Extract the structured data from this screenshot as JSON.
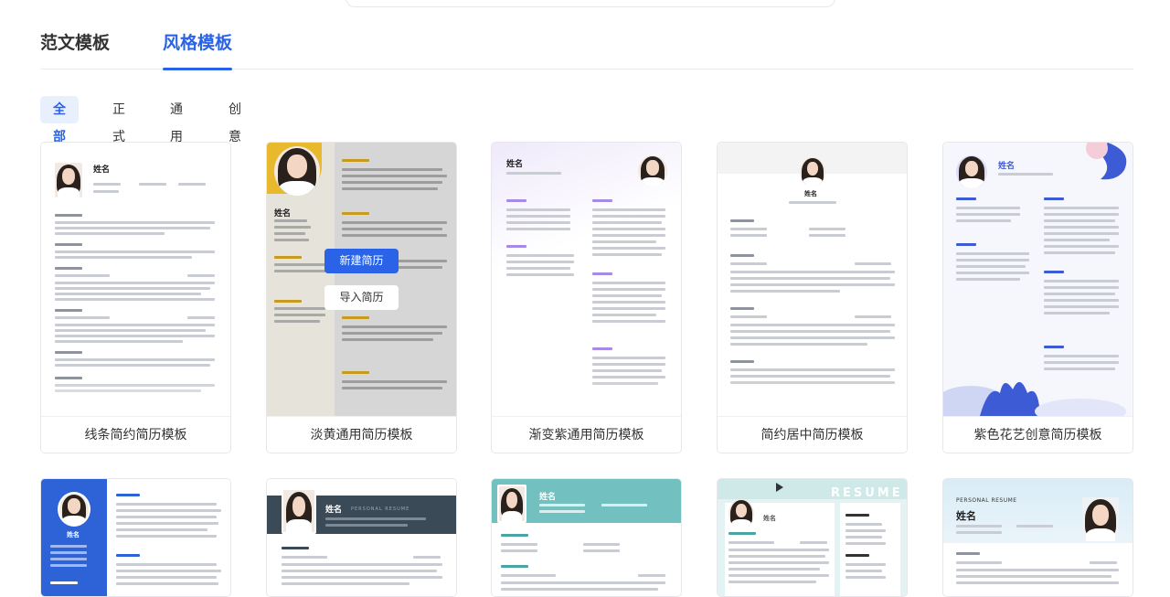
{
  "tabs": [
    {
      "label": "范文模板",
      "active": false
    },
    {
      "label": "风格模板",
      "active": true
    }
  ],
  "filters": [
    {
      "label": "全部",
      "active": true
    },
    {
      "label": "正式",
      "active": false
    },
    {
      "label": "通用",
      "active": false
    },
    {
      "label": "创意",
      "active": false
    }
  ],
  "hover_actions": {
    "new_label": "新建简历",
    "import_label": "导入简历"
  },
  "templates": [
    {
      "name": "线条简约简历模板",
      "resume_name": "姓名"
    },
    {
      "name": "淡黄通用简历模板",
      "resume_name": "姓名"
    },
    {
      "name": "渐变紫通用简历模板",
      "resume_name": "姓名"
    },
    {
      "name": "简约居中简历模板",
      "resume_name": "姓名"
    },
    {
      "name": "紫色花艺创意简历模板",
      "resume_name": "姓名"
    }
  ],
  "templates_row2": [
    {
      "resume_name": "姓名"
    },
    {
      "resume_name": "姓名",
      "subtitle": "PERSONAL RESUME"
    },
    {
      "resume_name": "姓名"
    },
    {
      "resume_name": "姓名",
      "subtitle": "RESUME"
    },
    {
      "resume_name": "姓名",
      "subtitle": "PERSONAL RESUME"
    }
  ],
  "colors": {
    "accent": "#2a63e8",
    "chip_bg": "#e9f0fd",
    "yellow": "#f2c94c",
    "purple": "#b7a6ee",
    "teal": "#6ec0c0"
  }
}
